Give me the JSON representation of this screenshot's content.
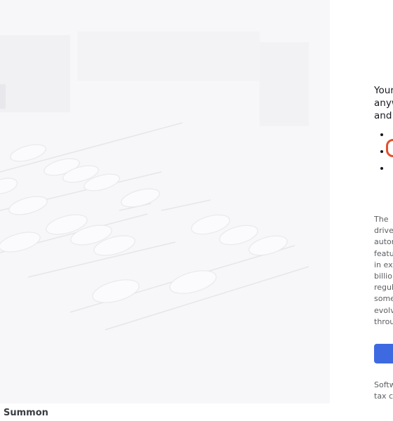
{
  "hero": {
    "caption": "Summon",
    "image_label": "parking-lot-illustration"
  },
  "panel": {
    "headline_lines": [
      "Your",
      "anyw",
      "and"
    ],
    "bullets": [
      "",
      "",
      ""
    ],
    "description_lines": [
      "The",
      "drive",
      "auton",
      "featu",
      "in ex",
      "billio",
      "regul",
      "some",
      "evolv",
      "throu"
    ],
    "cta_label": "",
    "footnote_lines": [
      "Softw",
      "tax c"
    ]
  },
  "colors": {
    "accent": "#3e6ae1",
    "info_icon": "#e2502d",
    "background": "#ffffff"
  }
}
